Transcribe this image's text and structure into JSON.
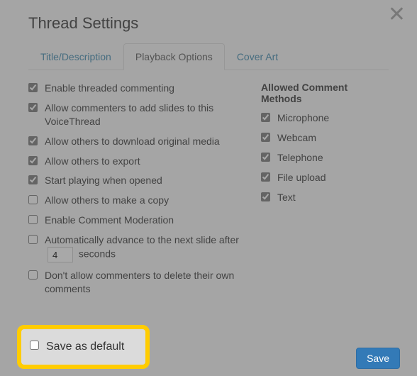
{
  "title": "Thread Settings",
  "tabs": {
    "title_desc": "Title/Description",
    "playback": "Playback Options",
    "cover": "Cover Art"
  },
  "options": {
    "threaded": "Enable threaded commenting",
    "add_slides": "Allow commenters to add slides to this VoiceThread",
    "download": "Allow others to download original media",
    "export": "Allow others to export",
    "start_play": "Start playing when opened",
    "copy": "Allow others to make a copy",
    "moderation": "Enable Comment Moderation",
    "auto_prefix": "Automatically advance to the next slide after",
    "auto_value": "4",
    "auto_suffix": "seconds",
    "no_delete": "Don't allow commenters to delete their own comments"
  },
  "methods": {
    "heading": "Allowed Comment Methods",
    "mic": "Microphone",
    "webcam": "Webcam",
    "telephone": "Telephone",
    "file": "File upload",
    "text": "Text"
  },
  "footer": {
    "save_default": "Save as default",
    "save": "Save"
  }
}
